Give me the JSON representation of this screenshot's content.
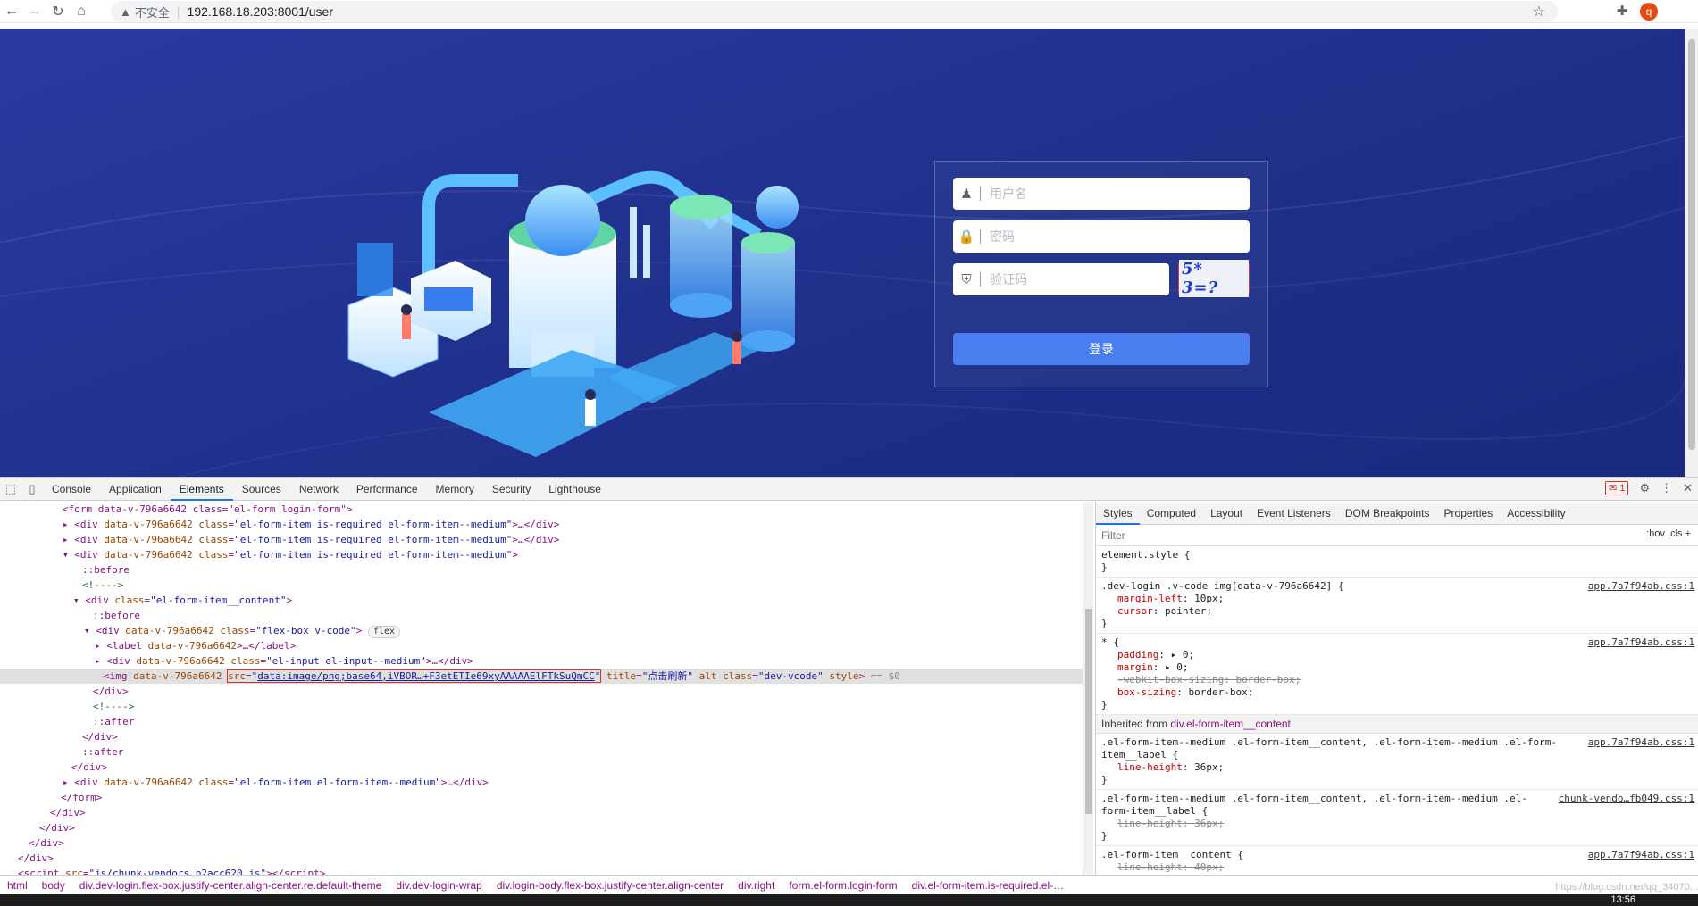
{
  "browser": {
    "security_warning": "不安全",
    "url": "192.168.18.203:8001/user",
    "profile_initial": "q"
  },
  "login": {
    "username_placeholder": "用户名",
    "password_placeholder": "密码",
    "vcode_placeholder": "验证码",
    "vcode_text": "5* 3=?",
    "submit_label": "登录"
  },
  "devtools": {
    "tabs": [
      "Console",
      "Application",
      "Elements",
      "Sources",
      "Network",
      "Performance",
      "Memory",
      "Security",
      "Lighthouse"
    ],
    "active_tab": "Elements",
    "error_count": "1",
    "styles_tabs": [
      "Styles",
      "Computed",
      "Layout",
      "Event Listeners",
      "DOM Breakpoints",
      "Properties",
      "Accessibility"
    ],
    "filter_placeholder": "Filter",
    "filter_options": ":hov  .cls  +",
    "breadcrumb": [
      "html",
      "body",
      "div.dev-login.flex-box.justify-center.align-center.re.default-theme",
      "div.dev-login-wrap",
      "div.login-body.flex-box.justify-center.align-center",
      "div.right",
      "form.el-form.login-form",
      "div.el-form-item.is-required.el-…"
    ],
    "clock": "13:56",
    "watermark": "https://blog.csdn.net/qq_34070..."
  },
  "colors": {
    "page_bg": "#1f2f8a",
    "login_button": "#4a7df0",
    "devtools_selected": "#e0e0e0",
    "highlight_border": "#d93025"
  }
}
